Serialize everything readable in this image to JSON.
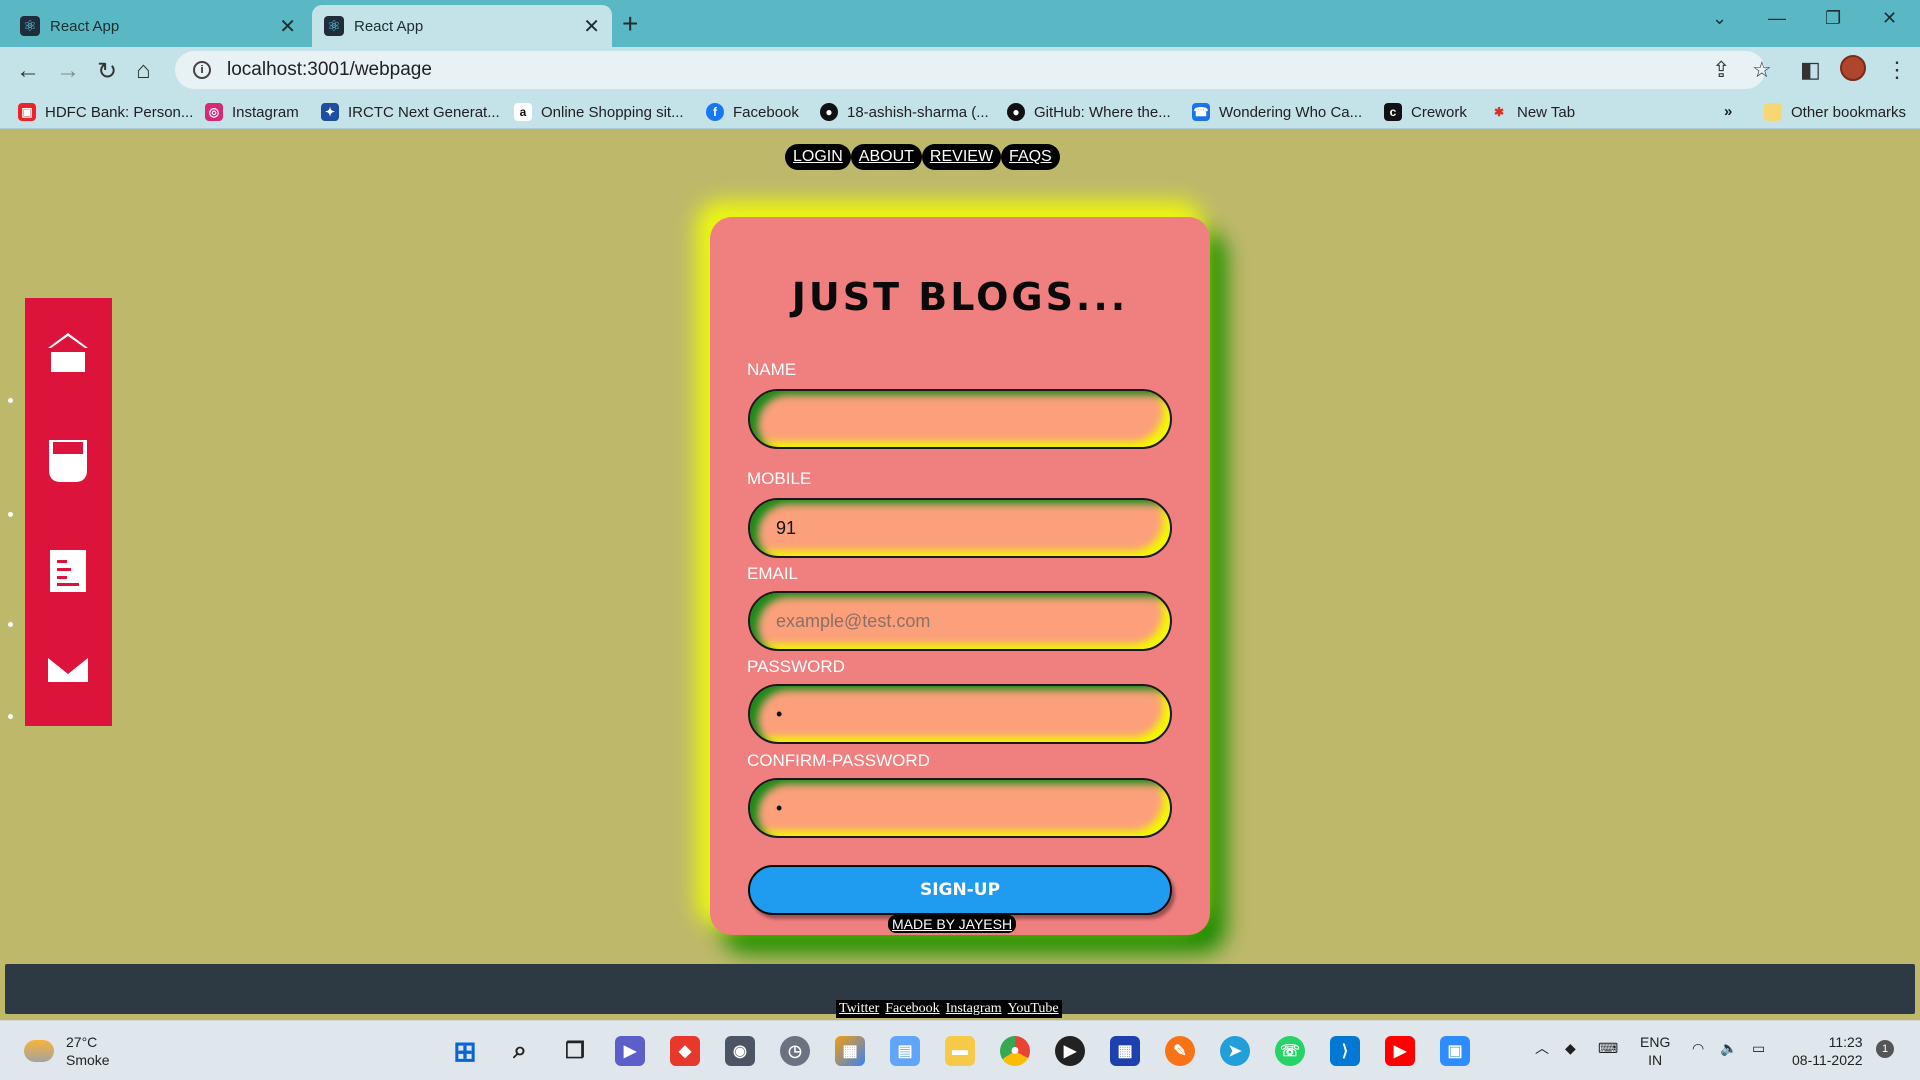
{
  "browser": {
    "tabs": [
      {
        "title": "React App",
        "active": false
      },
      {
        "title": "React App",
        "active": true
      }
    ],
    "url": "localhost:3001/webpage",
    "bookmarks": [
      {
        "label": "HDFC Bank: Person...",
        "icon": "hdfc-icon",
        "color": "#ed232a"
      },
      {
        "label": "Instagram",
        "icon": "instagram-icon",
        "color": "#d62976"
      },
      {
        "label": "IRCTC Next Generat...",
        "icon": "irctc-icon",
        "color": "#1d4ea0"
      },
      {
        "label": "Online Shopping sit...",
        "icon": "amazon-icon",
        "color": "#ffffff"
      },
      {
        "label": "Facebook",
        "icon": "facebook-icon",
        "color": "#1877f2"
      },
      {
        "label": "18-ashish-sharma (...",
        "icon": "github-icon",
        "color": "#111111"
      },
      {
        "label": "GitHub: Where the...",
        "icon": "github-icon",
        "color": "#111111"
      },
      {
        "label": "Wondering Who Ca...",
        "icon": "truecaller-icon",
        "color": "#1a73e8"
      },
      {
        "label": "Crework",
        "icon": "crework-icon",
        "color": "#111111"
      },
      {
        "label": "New Tab",
        "icon": "newtab-icon",
        "color": "#d93025"
      }
    ],
    "other_bookmarks": "Other bookmarks"
  },
  "nav": {
    "links": [
      "LOGIN",
      "ABOUT",
      "REVIEW",
      "FAQS"
    ]
  },
  "sidebar": {
    "icons": [
      "home-icon",
      "cup-icon",
      "document-icon",
      "mail-icon"
    ],
    "color": "#dc143c"
  },
  "form": {
    "title": "JUST BLOGS...",
    "fields": [
      {
        "label": "NAME",
        "value": "",
        "placeholder": ""
      },
      {
        "label": "MOBILE",
        "value": "91",
        "placeholder": ""
      },
      {
        "label": "EMAIL",
        "value": "",
        "placeholder": "example@test.com"
      },
      {
        "label": "PASSWORD",
        "value": "•",
        "placeholder": ""
      },
      {
        "label": "CONFIRM-PASSWORD",
        "value": "•",
        "placeholder": ""
      }
    ],
    "submit_label": "SIGN-UP",
    "credit": "MADE BY JAYESH"
  },
  "footer": {
    "links": [
      "Twitter",
      "Facebook",
      "Instagram",
      "YouTube"
    ]
  },
  "taskbar": {
    "weather_temp": "27°C",
    "weather_desc": "Smoke",
    "lang_top": "ENG",
    "lang_bottom": "IN",
    "time": "11:23",
    "date": "08-11-2022",
    "notification_count": "1"
  }
}
